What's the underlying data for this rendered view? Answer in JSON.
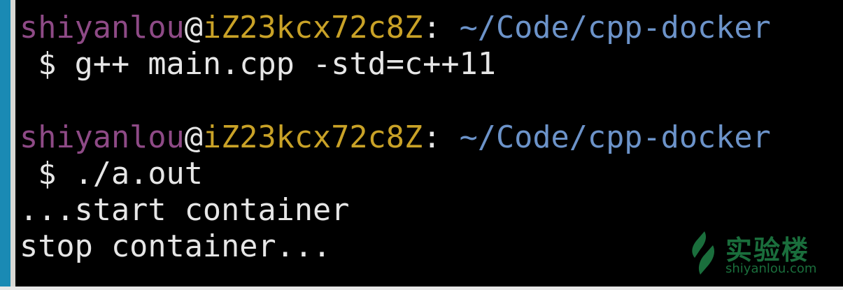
{
  "terminal": {
    "lines": [
      {
        "type": "prompt",
        "user": "shiyanlou",
        "at": "@",
        "host": "iZ23kcx72c8Z",
        "sep": ": ",
        "path": "~/Code/cpp-docker"
      },
      {
        "type": "text",
        "text": " $ g++ main.cpp -std=c++11"
      },
      {
        "type": "text",
        "text": ""
      },
      {
        "type": "prompt",
        "user": "shiyanlou",
        "at": "@",
        "host": "iZ23kcx72c8Z",
        "sep": ": ",
        "path": "~/Code/cpp-docker"
      },
      {
        "type": "text",
        "text": " $ ./a.out"
      },
      {
        "type": "text",
        "text": "...start container"
      },
      {
        "type": "text",
        "text": "stop container..."
      }
    ]
  },
  "watermark": {
    "title": "实验楼",
    "url": "shiyanlou.com",
    "color": "#1a6e3c"
  }
}
